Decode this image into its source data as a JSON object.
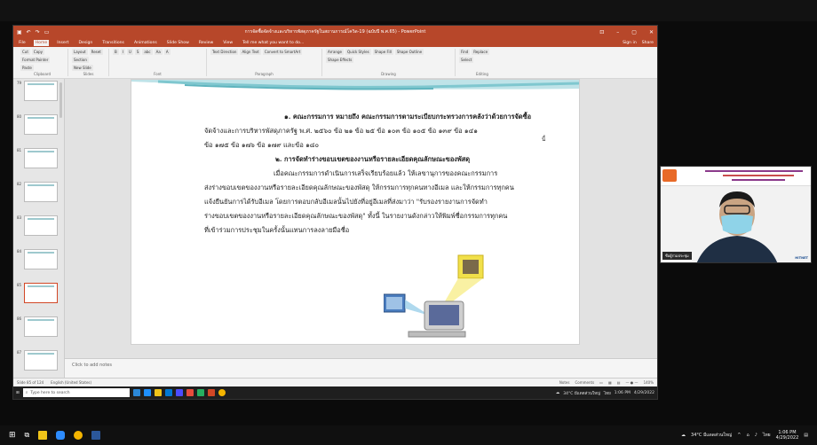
{
  "powerpoint": {
    "title": "การจัดซื้อจัดจ้างและบริหารพัสดุภาครัฐในสถานการณ์โควิด-19 (ฉบับปี พ.ศ.65) - PowerPoint",
    "tabs": [
      "File",
      "Home",
      "Insert",
      "Design",
      "Transitions",
      "Animations",
      "Slide Show",
      "Review",
      "View"
    ],
    "tell_me": "Tell me what you want to do...",
    "sign_in": "Sign in",
    "share": "Share",
    "ribbon_groups": [
      {
        "name": "Clipboard",
        "items": [
          "Cut",
          "Copy",
          "Format Painter",
          "Paste"
        ]
      },
      {
        "name": "Slides",
        "items": [
          "Layout",
          "Reset",
          "Section",
          "New Slide"
        ]
      },
      {
        "name": "Font",
        "items": [
          "B",
          "I",
          "U",
          "S",
          "abc",
          "Aa",
          "A"
        ]
      },
      {
        "name": "Paragraph",
        "items": [
          "Text Direction",
          "Align Text",
          "Convert to SmartArt"
        ]
      },
      {
        "name": "Drawing",
        "items": [
          "Arrange",
          "Quick Styles",
          "Shape Fill",
          "Shape Outline",
          "Shape Effects"
        ]
      },
      {
        "name": "Editing",
        "items": [
          "Find",
          "Replace",
          "Select"
        ]
      }
    ],
    "slide_numbers": [
      "79",
      "80",
      "81",
      "82",
      "83",
      "84",
      "85",
      "86",
      "87"
    ],
    "selected_slide": "85",
    "slide_lines": [
      "๑. คณะกรรมการ หมายถึง คณะกรรมการตามระเบียบกระทรวงการคลังว่าด้วยการจัดซื้อ",
      "จัดจ้างและการบริหารพัสดุภาครัฐ พ.ศ. ๒๕๖๐ ข้อ ๒๑ ข้อ ๒๕ ข้อ ๑๐๓ ข้อ ๑๐๕ ข้อ ๑๓๙ ข้อ ๑๔๑",
      "ข้อ ๑๗๕ ข้อ ๑๗๖ ข้อ ๑๗๙ และข้อ ๑๘๐",
      "๒. การจัดทำร่างขอบเขตของงานหรือรายละเอียดคุณลักษณะของพัสดุ",
      "เมื่อคณะกรรมการดำเนินการเสร็จเรียบร้อยแล้ว ให้เลขานุการของคณะกรรมการ",
      "ส่งร่างขอบเขตของงานหรือรายละเอียดคุณลักษณะของพัสดุ ให้กรรมการทุกคนทางอีเมล และให้กรรมการทุกคน",
      "แจ้งยืนยันการได้รับอีเมล โดยการตอบกลับอีเมลนั้นไปยังที่อยู่อีเมลที่ส่งมาว่า \"รับรองรายงานการจัดทำ",
      "ร่างขอบเขตของงานหรือรายละเอียดคุณลักษณะของพัสดุ\" ทั้งนี้ ในรายงานดังกล่าวให้พิมพ์ชื่อกรรมการทุกคน",
      "ที่เข้าร่วมการประชุมในครั้งนั้นแทนการลงลายมือชื่อ"
    ],
    "slide_tail": "นี้",
    "notes_placeholder": "Click to add notes",
    "status_left": "Slide 85 of 124",
    "status_lang": "English (United States)",
    "status_notes": "Notes",
    "status_comments": "Comments",
    "zoom": "140%",
    "inner_search_placeholder": "Type here to search",
    "inner_weather": "34°C มีแดดส่วนใหญ่",
    "inner_lang": "ไทย",
    "inner_time": "1:06 PM",
    "inner_date": "4/29/2022"
  },
  "video": {
    "name_label": "ชื่อผู้ร่วมประชุม",
    "right_logo": "HITNET"
  },
  "taskbar": {
    "weather": "34°C มีแดดส่วนใหญ่",
    "lang": "ไทย",
    "time": "1:06 PM",
    "date": "4/29/2022"
  }
}
